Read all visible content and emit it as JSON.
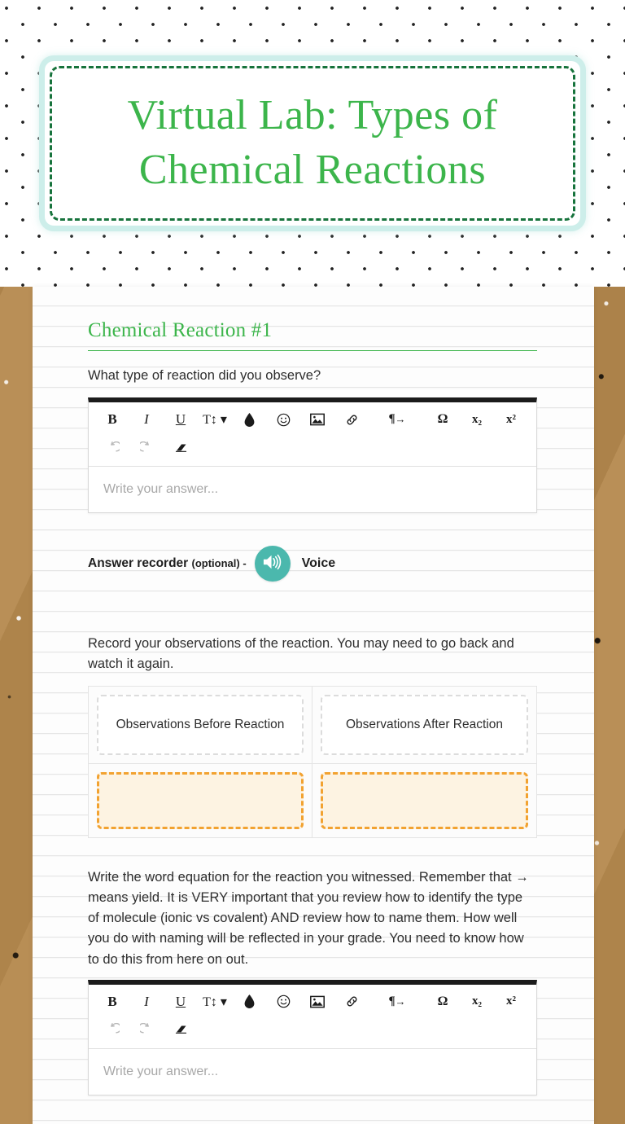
{
  "page": {
    "title": "Virtual Lab: Types of Chemical Reactions",
    "accent_green": "#3cb54b",
    "accent_dashed_green": "#17733c",
    "accent_cyan": "#cdeeea",
    "accent_teal": "#4bb8ad",
    "accent_orange": "#f2a230",
    "drop_zone_fill": "#fdf3e2",
    "cork_brown": "#b5894e"
  },
  "section": {
    "heading": "Chemical Reaction #1"
  },
  "questions": [
    {
      "prompt": "What type of reaction did you observe?",
      "editor_placeholder": "Write your answer..."
    },
    {
      "prompt": "Record your observations of the reaction.  You may need to go back and watch it again."
    },
    {
      "prompt": "Write the word equation for the reaction you witnessed.  Remember that → means yield.   It is VERY important that you review how to identify the type of molecule (ionic vs covalent) AND review how to name them.  How well you do with naming will be reflected in your grade.  You need to know how to do this from here on out.",
      "editor_placeholder": "Write your answer..."
    }
  ],
  "recorder": {
    "label_strong": "Answer recorder",
    "label_optional": "(optional) -",
    "voice_label": "Voice",
    "icon": "speaker-volume-icon"
  },
  "toolbar": {
    "row1": [
      {
        "name": "bold-button",
        "label": "B",
        "style": "b-bold",
        "dim": false
      },
      {
        "name": "italic-button",
        "label": "I",
        "style": "b-ital",
        "dim": false
      },
      {
        "name": "underline-button",
        "label": "U",
        "style": "b-under",
        "dim": false
      },
      {
        "name": "font-size-button",
        "label": "T↕ ▾",
        "style": "b-tsize",
        "dim": false
      },
      {
        "name": "text-color-droplet-icon",
        "label": "",
        "style": "icon-droplet",
        "dim": false
      },
      {
        "name": "emoji-smiley-icon",
        "label": "",
        "style": "icon-smiley",
        "dim": false
      },
      {
        "name": "insert-image-icon",
        "label": "",
        "style": "icon-image",
        "dim": false
      },
      {
        "name": "insert-link-icon",
        "label": "",
        "style": "icon-link",
        "dim": false
      },
      {
        "name": "text-direction-button",
        "label": "¶",
        "style": "b-para",
        "dim": false
      },
      {
        "name": "special-character-button",
        "label": "Ω",
        "style": "b-omega",
        "dim": false
      },
      {
        "name": "subscript-button",
        "label": "x₂",
        "style": "b-sub",
        "dim": false
      },
      {
        "name": "superscript-button",
        "label": "x²",
        "style": "b-sup",
        "dim": false
      }
    ],
    "row2": [
      {
        "name": "undo-icon",
        "label": "↶",
        "dim": true
      },
      {
        "name": "redo-icon",
        "label": "↷",
        "dim": true
      },
      {
        "name": "clear-formatting-eraser-icon",
        "label": "",
        "dim": false
      }
    ]
  },
  "observation_table": {
    "headers": [
      "Observations Before Reaction",
      "Observations After Reaction"
    ],
    "drop_zones": [
      "",
      ""
    ]
  }
}
